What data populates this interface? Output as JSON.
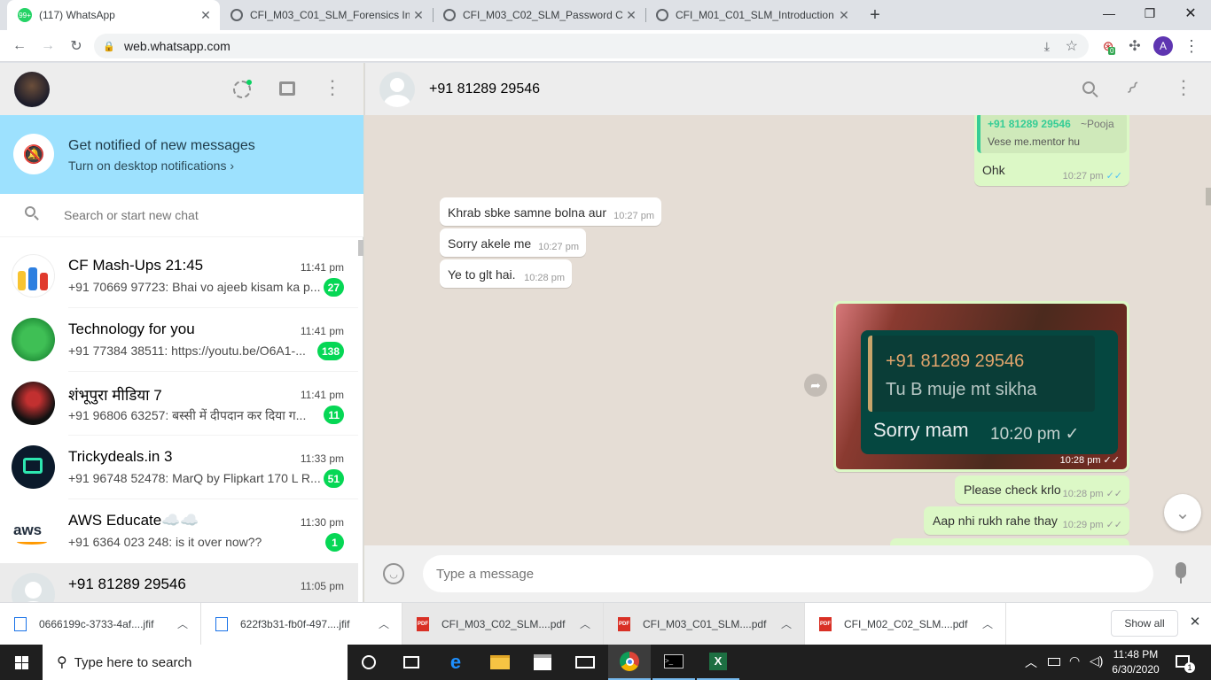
{
  "browser": {
    "tabs": [
      {
        "title": "(117) WhatsApp",
        "favicon": "whatsapp-icon",
        "badge": "99+",
        "active": true
      },
      {
        "title": "CFI_M03_C01_SLM_Forensics Inve",
        "favicon": "globe-icon",
        "active": false
      },
      {
        "title": "CFI_M03_C02_SLM_Password Cra",
        "favicon": "globe-icon",
        "active": false
      },
      {
        "title": "CFI_M01_C01_SLM_Introduction t",
        "favicon": "globe-icon",
        "active": false
      }
    ],
    "url": "web.whatsapp.com",
    "extension_badge": "0",
    "profile_initial": "A"
  },
  "sidebar": {
    "notification": {
      "title": "Get notified of new messages",
      "link": "Turn on desktop notifications ›"
    },
    "search_placeholder": "Search or start new chat",
    "chats": [
      {
        "name": "CF Mash-Ups  21:45",
        "time": "11:41 pm",
        "preview": "+91 70669 97723: Bhai vo ajeeb kisam ka p...",
        "unread": "27"
      },
      {
        "name": "Technology for you",
        "time": "11:41 pm",
        "preview": "+91 77384 38511: https://youtu.be/O6A1-...",
        "unread": "138"
      },
      {
        "name": "शंभूपुरा मीडिया 7",
        "time": "11:41 pm",
        "preview": "+91 96806 63257: बस्सी में दीपदान कर दिया ग...",
        "unread": "11"
      },
      {
        "name": "Trickydeals.in 3",
        "time": "11:33 pm",
        "preview": "+91 96748 52478: MarQ by Flipkart 170 L R...",
        "unread": "51"
      },
      {
        "name": "AWS Educate☁️☁️",
        "time": "11:30 pm",
        "preview": "+91 6364 023 248: is it over now??",
        "unread": "1"
      },
      {
        "name": "+91 81289 29546",
        "time": "11:05 pm",
        "preview": "",
        "unread": ""
      }
    ]
  },
  "conversation": {
    "contact": "+91 81289 29546",
    "quoted": {
      "sender": "+91 81289 29546",
      "alias": "~Pooja",
      "text": "Vese me.mentor hu"
    },
    "messages": [
      {
        "text": "Ohk",
        "time": "10:27 pm",
        "dir": "out"
      },
      {
        "text": "Khrab sbke samne bolna aur",
        "time": "10:27 pm",
        "dir": "in"
      },
      {
        "text": "Sorry akele me",
        "time": "10:27 pm",
        "dir": "in"
      },
      {
        "text": "Ye to glt hai.",
        "time": "10:28 pm",
        "dir": "in"
      },
      {
        "text": "Please check krlo",
        "time": "10:28 pm",
        "dir": "out"
      },
      {
        "text": "Aap nhi rukh rahe thay",
        "time": "10:29 pm",
        "dir": "out"
      }
    ],
    "image_message": {
      "quote_sender": "+91 81289 29546",
      "quote_text": "Tu B muje mt sikha",
      "body": "Sorry mam",
      "inner_time": "10:20 pm",
      "time": "10:28 pm"
    },
    "input_placeholder": "Type a message"
  },
  "downloads": {
    "items": [
      {
        "name": "0666199c-3733-4af....jfif",
        "type": "image"
      },
      {
        "name": "622f3b31-fb0f-497....jfif",
        "type": "image"
      },
      {
        "name": "CFI_M03_C02_SLM....pdf",
        "type": "pdf"
      },
      {
        "name": "CFI_M03_C01_SLM....pdf",
        "type": "pdf"
      },
      {
        "name": "CFI_M02_C02_SLM....pdf",
        "type": "pdf"
      }
    ],
    "show_all": "Show all"
  },
  "taskbar": {
    "search_placeholder": "Type here to search",
    "time": "11:48 PM",
    "date": "6/30/2020",
    "notification_count": "1"
  },
  "colors": {
    "whatsapp_green": "#06d755",
    "notif_bg": "#9de1fe",
    "outgoing_bubble": "#dcf8c6",
    "chat_bg": "#e5ddd5"
  }
}
